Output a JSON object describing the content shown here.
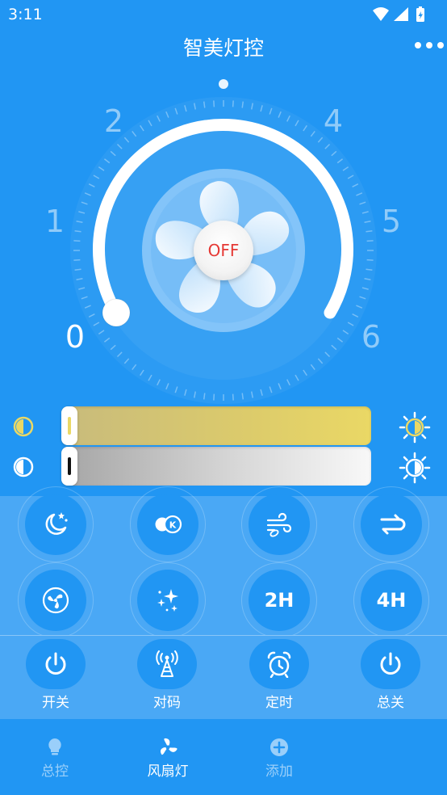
{
  "status_bar": {
    "time": "3:11"
  },
  "header": {
    "title": "智美灯控"
  },
  "dial": {
    "numbers": [
      "0",
      "1",
      "2",
      "4",
      "5",
      "6"
    ],
    "active_number": "0",
    "power_label": "OFF"
  },
  "sliders": {
    "color_temperature": {
      "value": 0
    },
    "brightness": {
      "value": 0
    }
  },
  "modes": {
    "row1": [
      "moon-stars-icon",
      "color-toggle-icon",
      "wind-icon",
      "cycle-icon"
    ],
    "row2": [
      "fan-swing-icon",
      "sparkle-icon",
      "2H",
      "4H"
    ]
  },
  "functions": [
    {
      "label": "开关",
      "icon": "power-icon"
    },
    {
      "label": "对码",
      "icon": "signal-tower-icon"
    },
    {
      "label": "定时",
      "icon": "alarm-clock-icon"
    },
    {
      "label": "总关",
      "icon": "power-icon"
    }
  ],
  "nav": [
    {
      "label": "总控",
      "icon": "bulb-icon",
      "active": false
    },
    {
      "label": "风扇灯",
      "icon": "fan-icon",
      "active": true
    },
    {
      "label": "添加",
      "icon": "add-circle-icon",
      "active": false
    }
  ],
  "colors": {
    "primary": "#2196f3",
    "panel": "#4aa8f5",
    "off_text": "#e53935",
    "warm": "#ead865"
  }
}
